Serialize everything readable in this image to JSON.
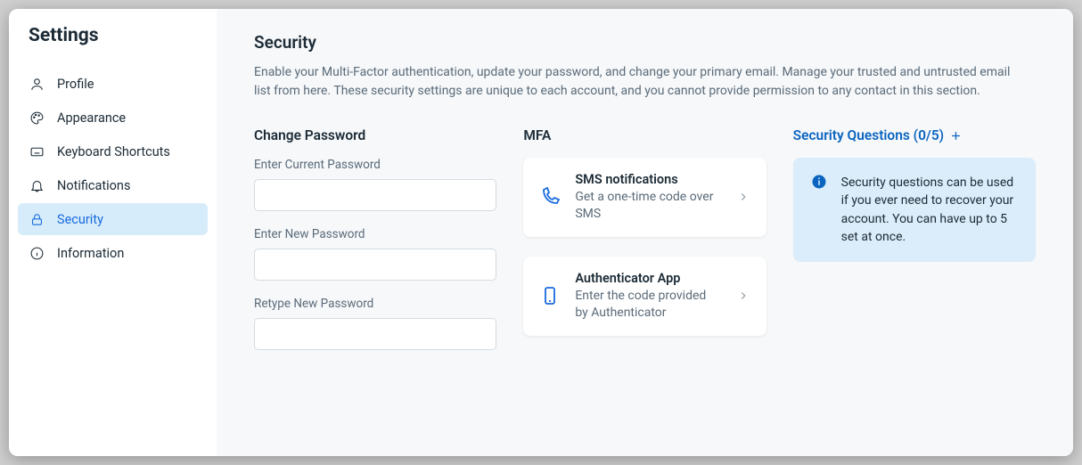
{
  "sidebar": {
    "title": "Settings",
    "items": [
      {
        "label": "Profile"
      },
      {
        "label": "Appearance"
      },
      {
        "label": "Keyboard Shortcuts"
      },
      {
        "label": "Notifications"
      },
      {
        "label": "Security"
      },
      {
        "label": "Information"
      }
    ]
  },
  "page": {
    "title": "Security",
    "description": "Enable your Multi-Factor authentication, update your password, and change your primary email. Manage your trusted and untrusted email list from here. These security settings are unique to each account, and you cannot provide permission to any contact in this section."
  },
  "password": {
    "heading": "Change Password",
    "current_label": "Enter Current Password",
    "new_label": "Enter New Password",
    "retype_label": "Retype New Password",
    "current_value": "",
    "new_value": "",
    "retype_value": ""
  },
  "mfa": {
    "heading": "MFA",
    "sms": {
      "title": "SMS notifications",
      "desc": "Get a one-time code over SMS"
    },
    "auth": {
      "title": "Authenticator App",
      "desc": "Enter the code provided by Authenticator"
    }
  },
  "questions": {
    "heading": "Security Questions (0/5)",
    "info": "Security questions can be used if you ever need to recover your account. You can have up to 5 set at once."
  }
}
